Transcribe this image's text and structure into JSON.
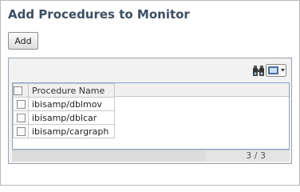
{
  "title": "Add Procedures to Monitor",
  "toolbar": {
    "add_label": "Add"
  },
  "grid": {
    "column_header": "Procedure Name",
    "rows": [
      {
        "name": "ibisamp/dblmov"
      },
      {
        "name": "ibisamp/dblcar"
      },
      {
        "name": "ibisamp/cargraph"
      }
    ],
    "page_count": "3 / 3"
  },
  "icons": {
    "find": "binoculars-icon",
    "view": "view-options-icon"
  }
}
